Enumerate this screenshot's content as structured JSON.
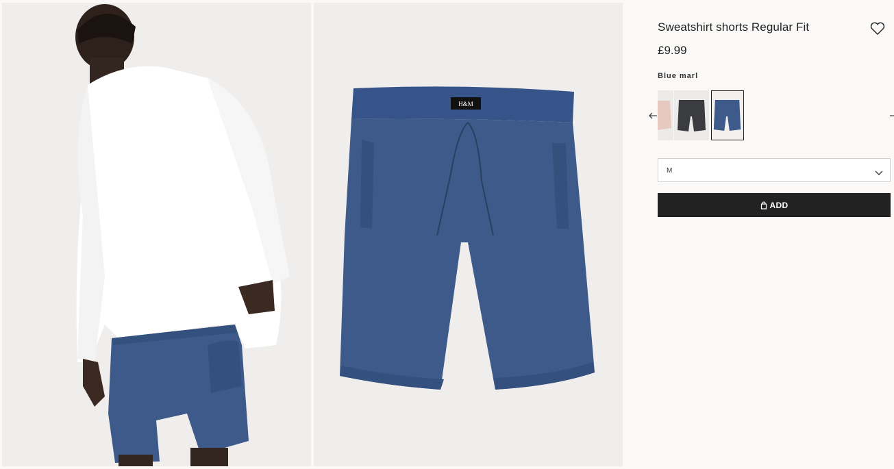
{
  "product": {
    "title": "Sweatshirt shorts Regular Fit",
    "price": "£9.99",
    "selected_color": "Blue marl",
    "colors": [
      {
        "name": "pink",
        "hex": "#e8c9c2"
      },
      {
        "name": "black",
        "hex": "#3b3c40"
      },
      {
        "name": "blue",
        "hex": "#3d5a8a"
      }
    ],
    "size": "M",
    "add_label": "ADD"
  },
  "images": {
    "model_alt": "model-back-view-photo",
    "product_alt": "shorts-product-photo",
    "label_text": "H&M"
  },
  "icons": {
    "favorite": "heart-icon",
    "prev": "arrow-left-icon",
    "next": "arrow-right-icon",
    "dropdown": "chevron-down-icon",
    "bag": "bag-icon"
  },
  "colors": {
    "add_button_bg": "#222222",
    "page_bg": "#faf9f8",
    "photo_bg": "#efeeec",
    "shorts_blue": "#3d5a8a"
  }
}
